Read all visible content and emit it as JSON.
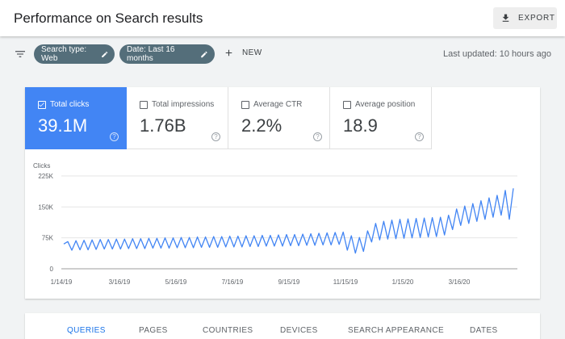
{
  "header": {
    "title": "Performance on Search results",
    "export_label": "EXPORT"
  },
  "filters": {
    "chips": [
      {
        "label": "Search type: Web"
      },
      {
        "label": "Date: Last 16 months"
      }
    ],
    "new_label": "NEW",
    "last_updated": "Last updated: 10 hours ago"
  },
  "metrics": [
    {
      "label": "Total clicks",
      "value": "39.1M",
      "checked": true,
      "color": "#4285f4"
    },
    {
      "label": "Total impressions",
      "value": "1.76B",
      "checked": false
    },
    {
      "label": "Average CTR",
      "value": "2.2%",
      "checked": false
    },
    {
      "label": "Average position",
      "value": "18.9",
      "checked": false
    }
  ],
  "chart_data": {
    "type": "line",
    "ylabel": "Clicks",
    "ylim": [
      0,
      225000
    ],
    "y_ticks": [
      "0",
      "75K",
      "150K",
      "225K"
    ],
    "x_tick_labels": [
      "1/14/19",
      "3/16/19",
      "5/16/19",
      "7/16/19",
      "9/15/19",
      "11/15/19",
      "1/15/20",
      "3/16/20"
    ],
    "series_color": "#4285f4",
    "grid": true,
    "series": [
      {
        "values": [
          60000,
          66000,
          45000,
          68000,
          46000,
          69000,
          46000,
          70000,
          47000,
          71000,
          48000,
          71000,
          48000,
          72000,
          48000,
          72000,
          49000,
          73000,
          49000,
          73000,
          49000,
          74000,
          50000,
          74000,
          50000,
          75000,
          50000,
          75000,
          51000,
          76000,
          51000,
          76000,
          51000,
          77000,
          52000,
          77000,
          52000,
          78000,
          52000,
          78000,
          53000,
          79000,
          53000,
          79000,
          53000,
          80000,
          54000,
          80000,
          54000,
          81000,
          55000,
          81000,
          55000,
          82000,
          55000,
          83000,
          56000,
          83000,
          56000,
          84000,
          57000,
          85000,
          57000,
          86000,
          58000,
          87000,
          58000,
          88000,
          59000,
          89000,
          45000,
          80000,
          38000,
          76000,
          42000,
          92000,
          65000,
          110000,
          70000,
          115000,
          72000,
          118000,
          73000,
          120000,
          74000,
          121000,
          75000,
          122000,
          76000,
          123000,
          77000,
          124000,
          78000,
          125000,
          82000,
          130000,
          95000,
          145000,
          105000,
          152000,
          110000,
          158000,
          115000,
          165000,
          120000,
          172000,
          125000,
          178000,
          130000,
          190000,
          120000,
          195000
        ]
      }
    ]
  },
  "tabs": [
    {
      "label": "QUERIES",
      "active": true
    },
    {
      "label": "PAGES"
    },
    {
      "label": "COUNTRIES"
    },
    {
      "label": "DEVICES"
    },
    {
      "label": "SEARCH APPEARANCE"
    },
    {
      "label": "DATES"
    }
  ]
}
